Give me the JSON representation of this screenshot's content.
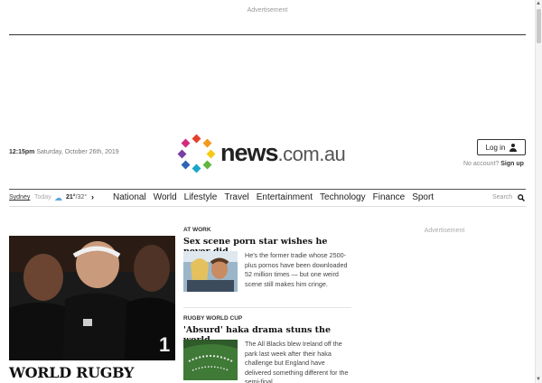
{
  "ads": {
    "top_label": "Advertisement",
    "side_label": "Advertisement"
  },
  "header": {
    "time": "12:15pm",
    "date": "Saturday, October 26th, 2019",
    "logo_main": "news",
    "logo_suffix": ".com.au",
    "login_label": "Log in",
    "no_account_label": "No account?",
    "signup_label": "Sign up"
  },
  "nav": {
    "city": "Sydney",
    "today_label": "Today",
    "temp_low": "21°",
    "temp_high": "/32°",
    "links": [
      "National",
      "World",
      "Lifestyle",
      "Travel",
      "Entertainment",
      "Technology",
      "Finance",
      "Sport"
    ],
    "search_label": "Search"
  },
  "hero": {
    "caption": "WORLD RUGBY"
  },
  "stories": [
    {
      "kicker": "AT WORK",
      "headline": "Sex scene porn star wishes he never did",
      "body": "He's the former tradie whose 2500-plus pornos have been downloaded 52 million times — but one weird scene still makes him cringe."
    },
    {
      "kicker": "RUGBY WORLD CUP",
      "headline": "'Absurd' haka drama stuns the world",
      "body": "The All Blacks blew Ireland off the park last week after their haka challenge but England have delivered something different for the semi-final."
    }
  ],
  "colors": {
    "weather_icon": "#5aa6d8",
    "hero_bg": "#171717"
  },
  "icons": {
    "weather": "sun-cloud-icon",
    "arrow": "chevron-right-icon",
    "search": "search-icon",
    "user": "user-icon"
  }
}
